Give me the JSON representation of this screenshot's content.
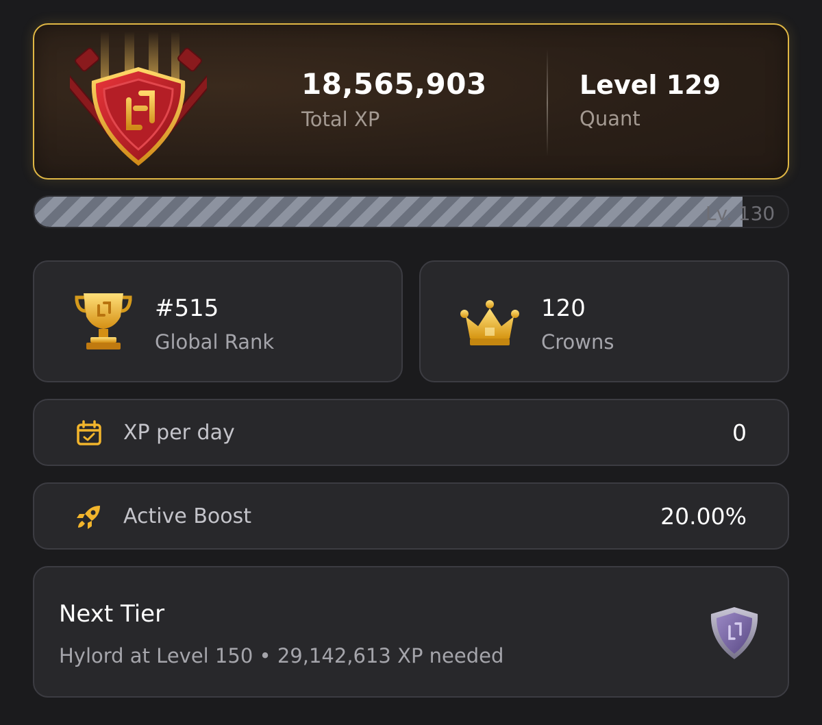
{
  "hero": {
    "total_xp_value": "18,565,903",
    "total_xp_label": "Total XP",
    "level_value": "Level 129",
    "level_label": "Quant",
    "emblem_icon": "red-shield-crossed-hammers-icon",
    "border_color": "#e1b845"
  },
  "progress": {
    "label": "Lv. 130",
    "fraction": 0.94
  },
  "stats": [
    {
      "icon": "gold-trophy-icon",
      "value": "#515",
      "label": "Global Rank"
    },
    {
      "icon": "gold-crown-icon",
      "value": "120",
      "label": "Crowns"
    }
  ],
  "rows": [
    {
      "icon": "calendar-check-icon",
      "label": "XP per day",
      "value": "0"
    },
    {
      "icon": "rocket-icon",
      "label": "Active Boost",
      "value": "20.00%"
    }
  ],
  "next_tier": {
    "title": "Next Tier",
    "description": "Hylord at Level 150 • 29,142,613 XP needed",
    "badge_icon": "purple-shield-icon"
  },
  "colors": {
    "accent_gold": "#e1b845",
    "background": "#1b1b1d",
    "card": "#28282b"
  }
}
